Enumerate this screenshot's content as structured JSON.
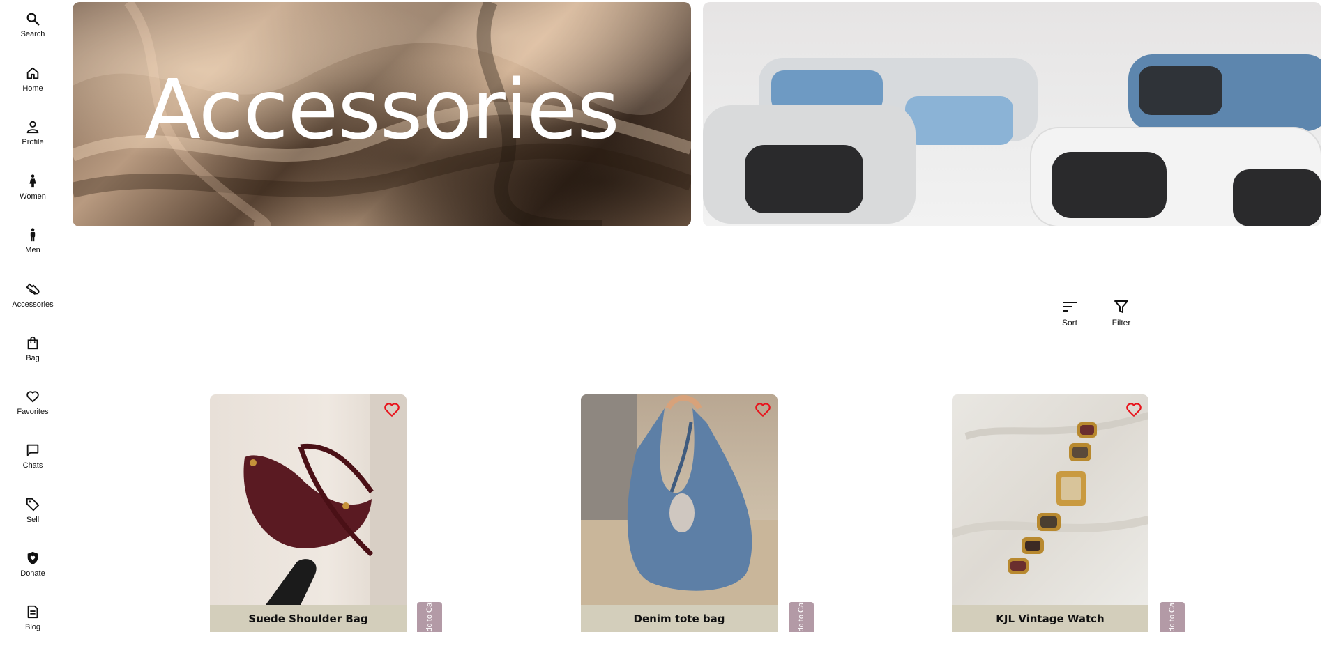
{
  "sidebar": {
    "items": [
      {
        "label": "Search",
        "icon": "search-icon"
      },
      {
        "label": "Home",
        "icon": "home-icon"
      },
      {
        "label": "Profile",
        "icon": "user-icon"
      },
      {
        "label": "Women",
        "icon": "woman-icon"
      },
      {
        "label": "Men",
        "icon": "man-icon"
      },
      {
        "label": "Accessories",
        "icon": "shoe-icon"
      },
      {
        "label": "Bag",
        "icon": "shopping-bag-icon"
      },
      {
        "label": "Favorites",
        "icon": "heart-icon"
      },
      {
        "label": "Chats",
        "icon": "chat-icon"
      },
      {
        "label": "Sell",
        "icon": "tag-icon"
      },
      {
        "label": "Donate",
        "icon": "shield-heart-icon"
      },
      {
        "label": "Blog",
        "icon": "document-icon"
      }
    ]
  },
  "hero": {
    "title": "Accessories"
  },
  "toolbar": {
    "sort_label": "Sort",
    "filter_label": "Filter"
  },
  "products": [
    {
      "name": "Suede Shoulder Bag",
      "cart_label": "Add to Cart"
    },
    {
      "name": "Denim tote bag",
      "cart_label": "Add to Cart"
    },
    {
      "name": "KJL Vintage Watch",
      "cart_label": "Add to Cart"
    }
  ],
  "colors": {
    "name_bar": "#d3cebb",
    "cart_tab": "#b39aa6",
    "heart": "#e8141c"
  }
}
